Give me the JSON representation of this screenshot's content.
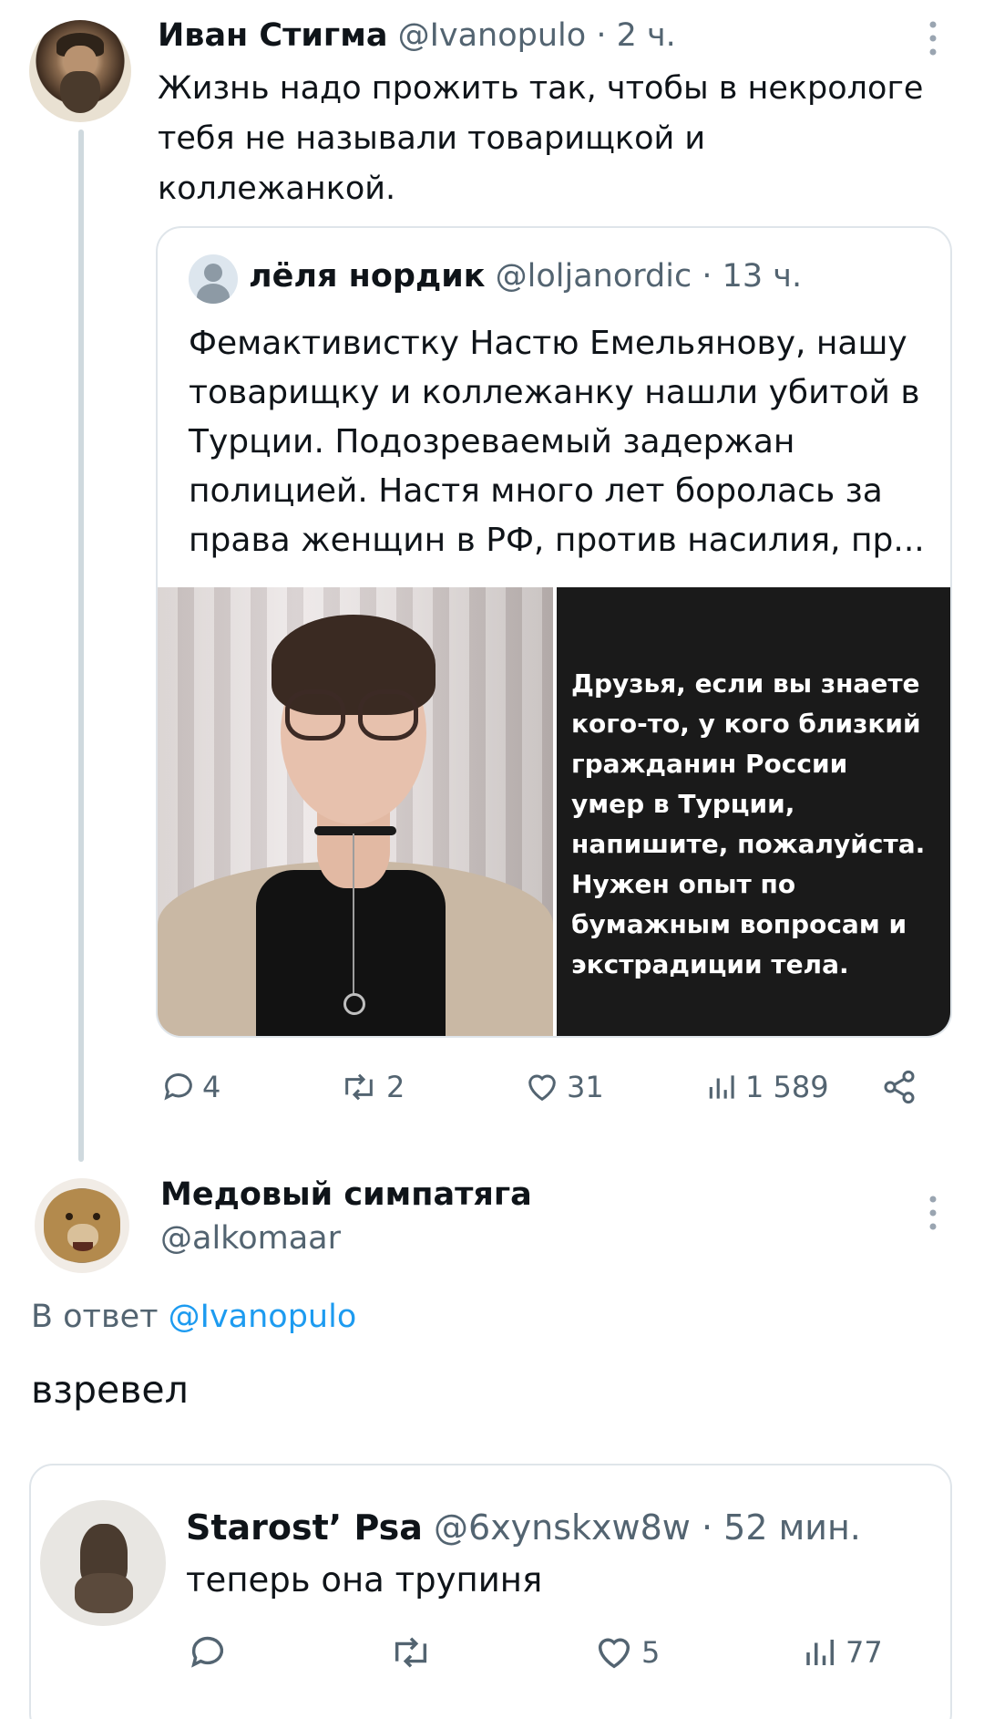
{
  "tweet1": {
    "name": "Иван Стигма",
    "handle": "@Ivanopulo",
    "time": "· 2 ч.",
    "text": "Жизнь надо прожить так, чтобы в  некрологе\nтебя не называли товарищкой и\nколлежанкой."
  },
  "quote": {
    "name": "лёля нордик",
    "handle": "@loljanordic",
    "time": "· 13 ч.",
    "text": "Фемактивистку Настю Емельянову, нашу\nтоварищку и коллежанку нашли убитой в\nТурции. Подозреваемый задержан\nполицией. Настя много лет боролась за\nправа женщин в РФ, против насилия, пр...",
    "image_text": "Друзья, если вы знаете\nкого-то, у кого близкий\nгражданин России\nумер в Турции,\nнапишите, пожалуйста.\nНужен опыт по\nбумажным вопросам и\nэкстрадиции тела."
  },
  "tweet1_actions": {
    "replies": "4",
    "reposts": "2",
    "likes": "31",
    "views": "1 589"
  },
  "tweet2": {
    "name": "Медовый симпатяга",
    "handle": "@alkomaar",
    "reply_prefix": "В ответ",
    "reply_mention": "@Ivanopulo",
    "text": "взревел"
  },
  "tweet3": {
    "name": "Starost’ Psa",
    "handle": "@6xynskxw8w",
    "time": "· 52 мин.",
    "text": "теперь она трупиня",
    "replies": "",
    "reposts": "",
    "likes": "5",
    "views": "77"
  },
  "colors": {
    "text": "#0f1419",
    "secondary": "#536471",
    "link": "#1d9bf0",
    "border": "#dfe5ea",
    "thread_line": "#cfd9de"
  }
}
